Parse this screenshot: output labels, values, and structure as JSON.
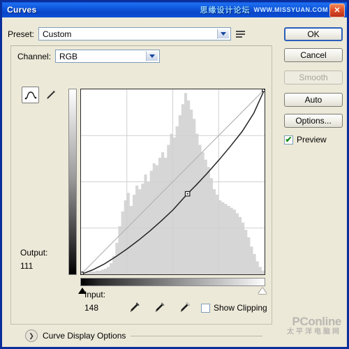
{
  "window": {
    "title": "Curves",
    "watermark_cn": "思缘设计论坛",
    "watermark_url": "WWW.MISSYUAN.COM",
    "close_glyph": "✕",
    "accent_color": "#0a46c8",
    "face_color": "#ece9d8"
  },
  "preset": {
    "label": "Preset:",
    "value": "Custom",
    "menu_icon": "preset-menu-icon"
  },
  "channel": {
    "label": "Channel:",
    "value": "RGB"
  },
  "tools": {
    "curve_icon": "curve-tool-icon",
    "pencil_icon": "pencil-tool-icon",
    "selected": "curve-tool-icon"
  },
  "graph": {
    "output_label": "Output:",
    "output_value": "111",
    "input_label": "Input:",
    "input_value": "148",
    "black_slider": "black-point-slider",
    "white_slider": "white-point-slider"
  },
  "eyedroppers": [
    {
      "name": "set-black-point-eyedropper"
    },
    {
      "name": "set-gray-point-eyedropper"
    },
    {
      "name": "set-white-point-eyedropper"
    }
  ],
  "show_clipping": {
    "label": "Show Clipping",
    "checked": false
  },
  "curve_display_options": {
    "label": "Curve Display Options",
    "expanded": false,
    "chevron": "❯"
  },
  "buttons": {
    "ok": "OK",
    "cancel": "Cancel",
    "smooth": "Smooth",
    "smooth_disabled": true,
    "auto": "Auto",
    "options": "Options..."
  },
  "preview": {
    "label": "Preview",
    "checked": true,
    "tick": "✔"
  },
  "footer_watermark": {
    "main": "PConline",
    "sub": "太平洋电脑网"
  },
  "chart_data": {
    "type": "line",
    "title": "RGB Tone Curve",
    "xlabel": "Input",
    "ylabel": "Output",
    "xlim": [
      0,
      255
    ],
    "ylim": [
      0,
      255
    ],
    "grid": true,
    "grid_divisions": 4,
    "series": [
      {
        "name": "identity-baseline",
        "style": "diagonal-reference",
        "x": [
          0,
          255
        ],
        "y": [
          0,
          255
        ]
      },
      {
        "name": "rgb-curve",
        "style": "adjusted-curve",
        "x": [
          0,
          16,
          32,
          48,
          64,
          80,
          96,
          112,
          128,
          148,
          160,
          176,
          192,
          208,
          224,
          240,
          255
        ],
        "y": [
          0,
          6,
          14,
          24,
          35,
          47,
          60,
          74,
          89,
          111,
          123,
          140,
          158,
          177,
          197,
          222,
          255
        ]
      }
    ],
    "control_points": [
      {
        "input": 0,
        "output": 0
      },
      {
        "input": 148,
        "output": 111
      },
      {
        "input": 255,
        "output": 255
      }
    ],
    "histogram": {
      "name": "image-histogram",
      "bins": 64,
      "values": [
        2,
        2,
        2,
        3,
        3,
        4,
        4,
        5,
        6,
        8,
        12,
        20,
        34,
        52,
        68,
        80,
        88,
        74,
        86,
        96,
        92,
        98,
        108,
        100,
        112,
        120,
        118,
        126,
        132,
        126,
        140,
        152,
        148,
        160,
        172,
        184,
        196,
        188,
        178,
        168,
        152,
        140,
        132,
        124,
        116,
        104,
        92,
        86,
        80,
        78,
        76,
        74,
        72,
        70,
        66,
        62,
        56,
        48,
        40,
        30,
        22,
        14,
        8,
        4
      ]
    }
  }
}
